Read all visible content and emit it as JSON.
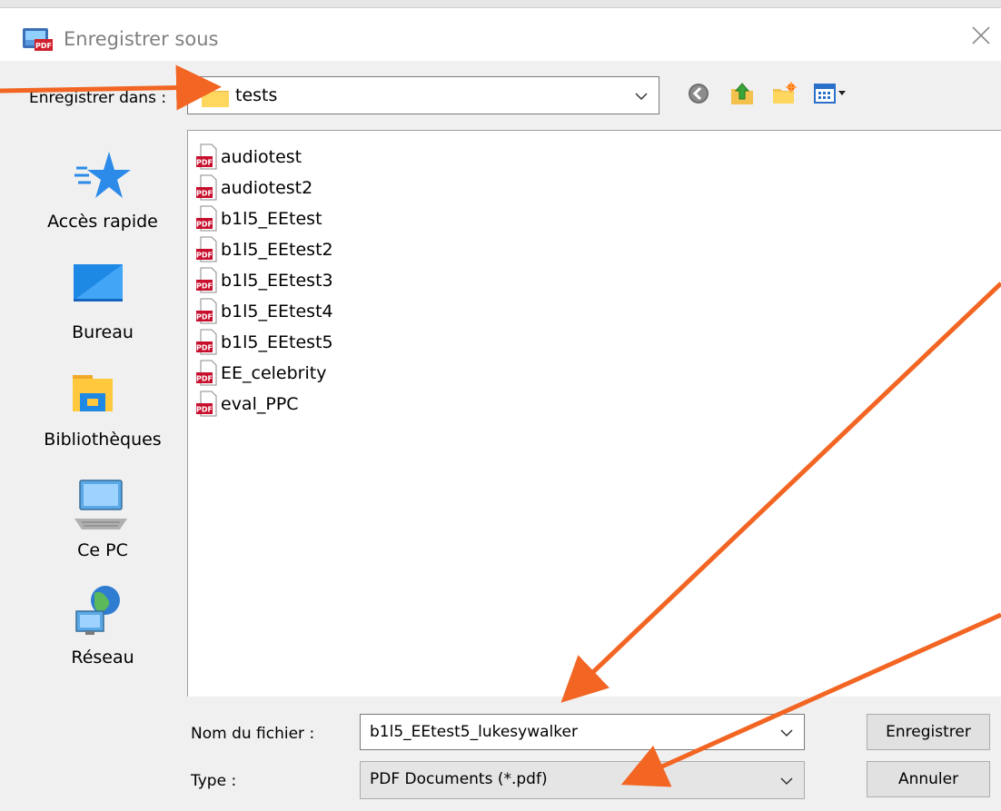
{
  "window": {
    "title": "Enregistrer sous",
    "title_icon": "pdf-app-icon",
    "close_icon": "close-icon"
  },
  "toolbar": {
    "save_in_label": "Enregistrer dans :",
    "save_in_value": "tests",
    "buttons": [
      "back-icon",
      "up-folder-icon",
      "new-folder-icon",
      "view-menu-icon"
    ]
  },
  "places": [
    {
      "label": "Accès rapide",
      "icon": "star-icon"
    },
    {
      "label": "Bureau",
      "icon": "desktop-icon"
    },
    {
      "label": "Bibliothèques",
      "icon": "libraries-icon"
    },
    {
      "label": "Ce PC",
      "icon": "computer-icon"
    },
    {
      "label": "Réseau",
      "icon": "network-icon"
    }
  ],
  "files": [
    {
      "name": "audiotest"
    },
    {
      "name": "audiotest2"
    },
    {
      "name": "b1l5_EEtest"
    },
    {
      "name": "b1l5_EEtest2"
    },
    {
      "name": "b1l5_EEtest3"
    },
    {
      "name": "b1l5_EEtest4"
    },
    {
      "name": "b1l5_EEtest5"
    },
    {
      "name": "EE_celebrity"
    },
    {
      "name": "eval_PPC"
    }
  ],
  "file_icon": {
    "badge_text": "PDF",
    "badge_color": "#c8102e"
  },
  "bottom": {
    "filename_label": "Nom du fichier :",
    "filename_value": "b1l5_EEtest5_lukesywalker",
    "type_label": "Type :",
    "type_value": "PDF Documents (*.pdf)",
    "save_button": "Enregistrer",
    "cancel_button": "Annuler"
  },
  "colors": {
    "annotation_arrow": "#f26522",
    "window_bg": "#f0f0f0",
    "folder_yellow": "#ffd75e"
  }
}
